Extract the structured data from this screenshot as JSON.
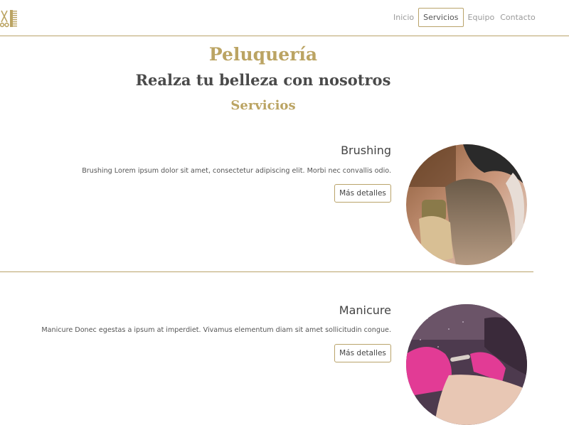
{
  "nav": {
    "items": [
      "Inicio",
      "Servicios",
      "Equipo",
      "Contacto"
    ],
    "active_index": 1
  },
  "hero": {
    "title": "Peluquería",
    "subtitle": "Realza tu belleza con nosotros",
    "section_title": "Servicios"
  },
  "services": [
    {
      "name": "Brushing",
      "description": "Brushing Lorem ipsum dolor sit amet, consectetur adipiscing elit. Morbi nec convallis odio.",
      "button_label": "Más detalles"
    },
    {
      "name": "Manicure",
      "description": "Manicure Donec egestas a ipsum at imperdiet. Vivamus elementum diam sit amet sollicitudin congue.",
      "button_label": "Más detalles"
    }
  ],
  "colors": {
    "accent": "#bba463",
    "border": "#b9a36a",
    "heading": "#4a4a4a",
    "nav_text": "#9a9a9a"
  },
  "icons": {
    "logo": "scissors-comb-icon"
  }
}
